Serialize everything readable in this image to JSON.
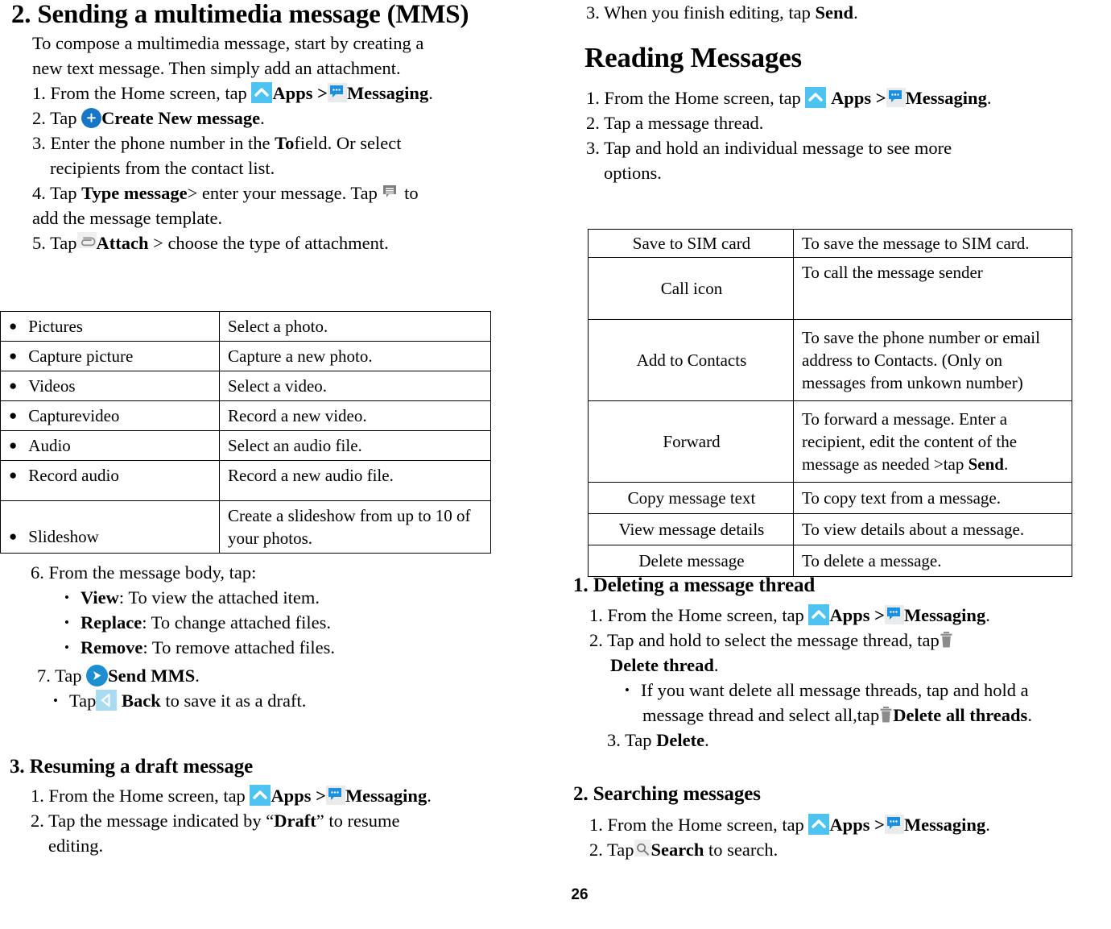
{
  "page": {
    "number": "26"
  },
  "left": {
    "section_mms": {
      "heading": "2. Sending a multimedia message (MMS)",
      "intro_line1": "To compose a multimedia message, start by creating a",
      "intro_line2": "new text message. Then simply add an attachment.",
      "step1_prefix": "1. From the Home screen, tap",
      "step1_apps": "Apps",
      "step1_sep": ">",
      "step1_messaging": "Messaging",
      "step1_period": ".",
      "step2_prefix": "2. Tap",
      "step2_bold": "Create New message",
      "step2_period": ".",
      "step3_line1_a": "3. Enter the phone number in the ",
      "step3_line1_b": "To",
      "step3_line1_c": "field.    Or select",
      "step3_line2": "recipients from the contact list.",
      "step4_a": "4. Tap ",
      "step4_b": "Type message",
      "step4_c": "> enter your message. Tap",
      "step4_d": "to",
      "step4_line2": "add the message template.",
      "step5_a": "5. Tap",
      "step5_b": "Attach",
      "step5_c": "> choose the type of attachment."
    },
    "attachment_table": {
      "rows": [
        {
          "term": "Pictures",
          "desc": "Select a photo."
        },
        {
          "term": "Capture picture",
          "desc": "Capture a new photo."
        },
        {
          "term": "Videos",
          "desc": "Select a video."
        },
        {
          "term": "Capturevideo",
          "desc": "Record a new video."
        },
        {
          "term": "Audio",
          "desc": "Select an audio file."
        },
        {
          "term": "Record audio",
          "desc": "Record a new audio file."
        },
        {
          "term": "Slideshow",
          "desc": "Create a slideshow from up to 10 of your photos."
        }
      ]
    },
    "step6": {
      "intro": "6. From the message body, tap:",
      "bullets": [
        {
          "bold": "View",
          "rest": ": To view the attached item."
        },
        {
          "bold": "Replace",
          "rest": ": To change attached files."
        },
        {
          "bold": "Remove",
          "rest": ": To remove attached files."
        }
      ],
      "step7_prefix": "7. Tap",
      "step7_bold": "Send MMS",
      "step7_period": ".",
      "step7_sub_prefix": "Tap",
      "step7_sub_bold": "Back",
      "step7_sub_rest": "to save it as a draft."
    },
    "section_draft": {
      "heading": "3. Resuming a draft message",
      "step1_prefix": "1. From the Home screen, tap",
      "step1_apps": "Apps",
      "step1_sep": ">",
      "step1_messaging": "Messaging",
      "step1_period": ".",
      "step2_a": "2. Tap the message indicated by “",
      "step2_b": "Draft",
      "step2_c": "” to resume",
      "step2_line2": "editing."
    }
  },
  "right": {
    "top_step": {
      "a": "3. When you finish editing, tap ",
      "b": "Send",
      "c": "."
    },
    "section_reading": {
      "heading": "Reading Messages",
      "step1_prefix": "1. From the Home screen, tap",
      "step1_apps": "Apps",
      "step1_sep": ">",
      "step1_messaging": "Messaging",
      "step1_period": ".",
      "step2": "2. Tap a message thread.",
      "step3_line1": "3. Tap and hold an individual message to see more",
      "step3_line2": "options."
    },
    "options_table": {
      "rows": [
        {
          "term": "Save to SIM card",
          "desc": "To save the message to SIM card."
        },
        {
          "term": "Call icon",
          "desc": "To call the message sender"
        },
        {
          "term": "Add    to Contacts",
          "desc": "To save the phone number or email address to Contacts. (Only on messages from unkown number)"
        },
        {
          "term": "Forward",
          "desc_a": "To forward a message. Enter a recipient, edit the content of the message as needed >tap ",
          "desc_b": "Send",
          "desc_c": "."
        },
        {
          "term": "Copy message text",
          "desc": "To copy text from a message."
        },
        {
          "term": "View message details",
          "desc": "To view details about a message."
        },
        {
          "term": "Delete message",
          "desc": "To delete a message."
        }
      ]
    },
    "section_delete": {
      "heading": "1. Deleting a message thread",
      "step1_prefix": "1. From the Home screen, tap",
      "step1_apps": "Apps",
      "step1_sep": ">",
      "step1_messaging": "Messaging",
      "step1_period": ".",
      "step2_a": "2. Tap and hold to select the message thread, tap",
      "step2_b": "Delete thread",
      "step2_c": ".",
      "bullet_line1": "If you want delete all message threads, tap and hold a",
      "bullet_line2_a": "message thread and select all,tap",
      "bullet_line2_b": "Delete all threads",
      "bullet_line2_c": ".",
      "step3_a": "3. Tap ",
      "step3_b": "Delete",
      "step3_c": "."
    },
    "section_search": {
      "heading": "2. Searching messages",
      "step1_prefix": "1. From the Home screen, tap",
      "step1_apps": "Apps",
      "step1_sep": ">",
      "step1_messaging": "Messaging",
      "step1_period": ".",
      "step2_prefix": "2. Tap",
      "step2_bold": "Search",
      "step2_rest": "to search."
    }
  },
  "colors": {
    "apps_icon_bg": "#4FC3F0",
    "messaging_icon_bubble": "#1b8fe0",
    "plus_icon_bg": "#1877c4",
    "send_icon_bg": "#1d8fd0",
    "back_icon_bg": "#a9dcf2",
    "trash_icon": "#8c8c8c",
    "underline_accent": "#7ec9ec"
  },
  "icons": {
    "apps": "chevron-up-icon",
    "messaging": "speech-bubble-icon",
    "create_new": "plus-circle-icon",
    "template": "message-template-icon",
    "attach": "paperclip-icon",
    "send": "send-arrow-icon",
    "back": "back-triangle-icon",
    "delete": "trash-icon",
    "search": "magnifier-icon"
  }
}
